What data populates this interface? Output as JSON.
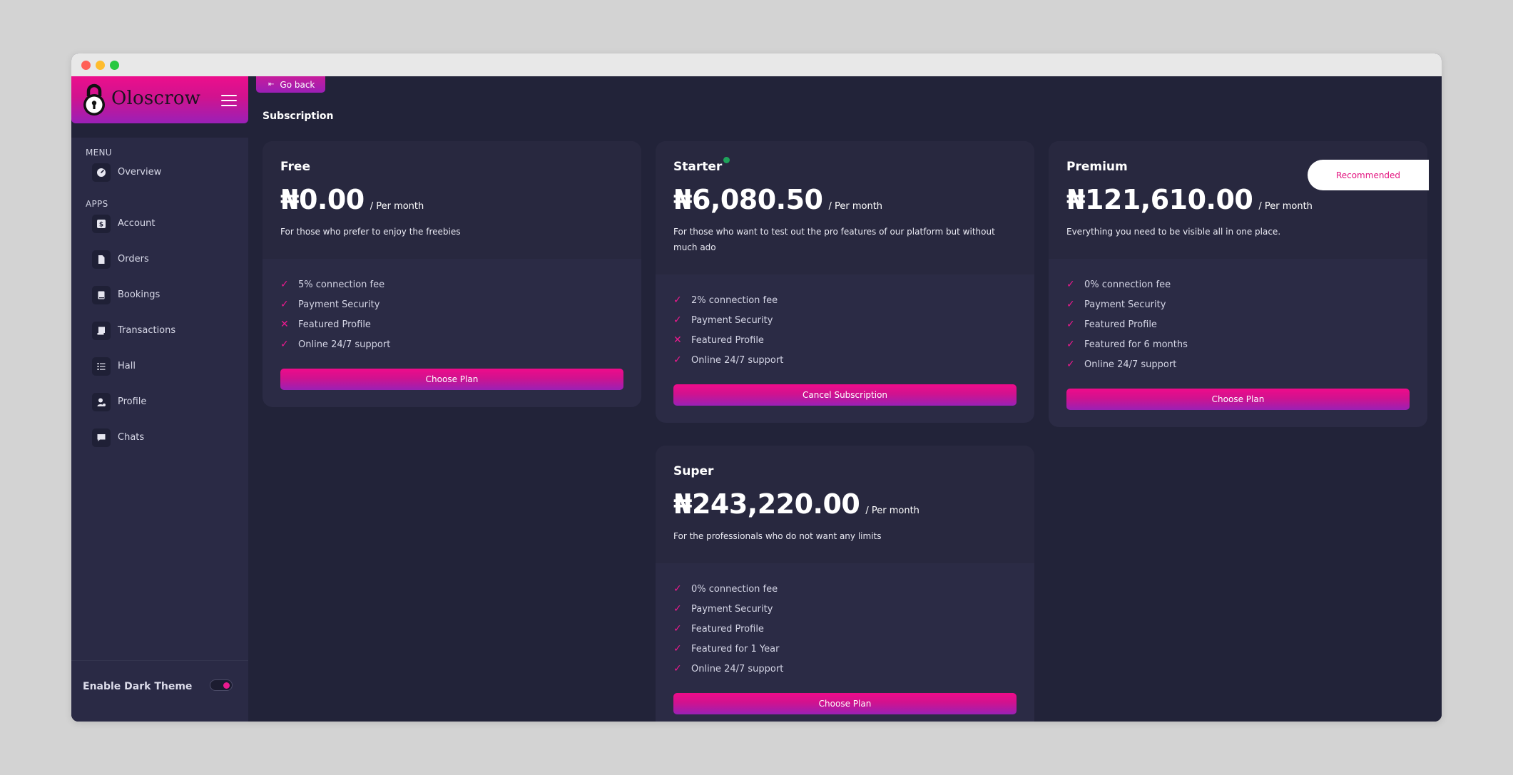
{
  "app": {
    "name": "Oloscrow"
  },
  "sidebar": {
    "menu_label": "MENU",
    "apps_label": "APPS",
    "menu_items": [
      {
        "label": "Overview",
        "icon": "gauge-icon"
      }
    ],
    "app_items": [
      {
        "label": "Account",
        "icon": "account-icon"
      },
      {
        "label": "Orders",
        "icon": "file-icon"
      },
      {
        "label": "Bookings",
        "icon": "book-icon"
      },
      {
        "label": "Transactions",
        "icon": "scroll-icon"
      },
      {
        "label": "Hall",
        "icon": "list-icon"
      },
      {
        "label": "Profile",
        "icon": "user-icon"
      },
      {
        "label": "Chats",
        "icon": "chat-icon"
      }
    ],
    "theme_toggle": {
      "label": "Enable Dark Theme",
      "enabled": true
    }
  },
  "header": {
    "go_back": "Go back",
    "title": "Subscription"
  },
  "badge": {
    "recommended": "Recommended"
  },
  "plans": [
    {
      "name": "Free",
      "price": "₦0.00",
      "period": "/ Per month",
      "description": "For those who prefer to enjoy the freebies",
      "features": [
        {
          "text": "5% connection fee",
          "included": true
        },
        {
          "text": "Payment Security",
          "included": true
        },
        {
          "text": "Featured Profile",
          "included": false
        },
        {
          "text": "Online 24/7 support",
          "included": true
        }
      ],
      "button": "Choose Plan"
    },
    {
      "name": "Starter",
      "price": "₦6,080.50",
      "period": "/ Per month",
      "description": "For those who want to test out the pro features of our platform but without much ado",
      "features": [
        {
          "text": "2% connection fee",
          "included": true
        },
        {
          "text": "Payment Security",
          "included": true
        },
        {
          "text": "Featured Profile",
          "included": false
        },
        {
          "text": "Online 24/7 support",
          "included": true
        }
      ],
      "button": "Cancel Subscription",
      "active": true
    },
    {
      "name": "Premium",
      "price": "₦121,610.00",
      "period": "/ Per month",
      "description": "Everything you need to be visible all in one place.",
      "features": [
        {
          "text": "0% connection fee",
          "included": true
        },
        {
          "text": "Payment Security",
          "included": true
        },
        {
          "text": "Featured Profile",
          "included": true
        },
        {
          "text": "Featured for 6 months",
          "included": true
        },
        {
          "text": "Online 24/7 support",
          "included": true
        }
      ],
      "button": "Choose Plan"
    },
    {
      "name": "Super",
      "price": "₦243,220.00",
      "period": "/ Per month",
      "description": "For the professionals who do not want any limits",
      "features": [
        {
          "text": "0% connection fee",
          "included": true
        },
        {
          "text": "Payment Security",
          "included": true
        },
        {
          "text": "Featured Profile",
          "included": true
        },
        {
          "text": "Featured for 1 Year",
          "included": true
        },
        {
          "text": "Online 24/7 support",
          "included": true
        }
      ],
      "button": "Choose Plan"
    }
  ],
  "colors": {
    "accent": "#ec1a8f",
    "accent_purple": "#9921b5",
    "background": "#222339",
    "card": "#2b2b45",
    "active_dot": "#1fa35b"
  }
}
